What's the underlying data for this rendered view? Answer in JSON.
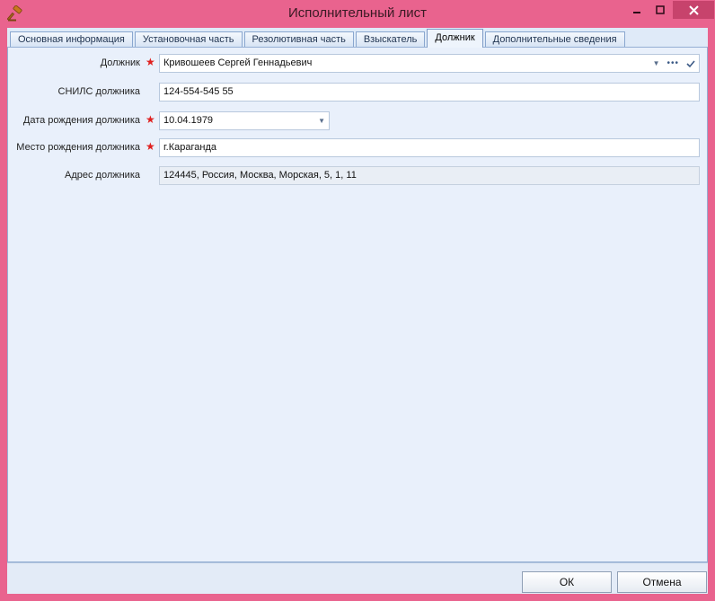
{
  "window": {
    "title": "Исполнительный лист",
    "icon": "gavel-icon"
  },
  "tabs": [
    {
      "label": "Основная информация",
      "active": false
    },
    {
      "label": "Установочная часть",
      "active": false
    },
    {
      "label": "Резолютивная часть",
      "active": false
    },
    {
      "label": "Взыскатель",
      "active": false
    },
    {
      "label": "Должник",
      "active": true
    },
    {
      "label": "Дополнительные сведения",
      "active": false
    }
  ],
  "form": {
    "debtor": {
      "label": "Должник",
      "required": true,
      "value": "Кривошеев Сергей Геннадьевич"
    },
    "snils": {
      "label": "СНИЛС должника",
      "required": false,
      "value": "124-554-545 55"
    },
    "birth_date": {
      "label": "Дата рождения должника",
      "required": true,
      "value": "10.04.1979"
    },
    "birth_place": {
      "label": "Место рождения должника",
      "required": true,
      "value": "г.Караганда"
    },
    "address": {
      "label": "Адрес должника",
      "required": false,
      "value": "124445, Россия, Москва, Морская, 5, 1, 11",
      "readonly": true
    }
  },
  "buttons": {
    "ok": "ОК",
    "cancel": "Отмена"
  },
  "colors": {
    "titlebar": "#e9638e",
    "close_button": "#c7436c",
    "required_star": "#e0201f",
    "panel_bg": "#e9f0fb"
  }
}
